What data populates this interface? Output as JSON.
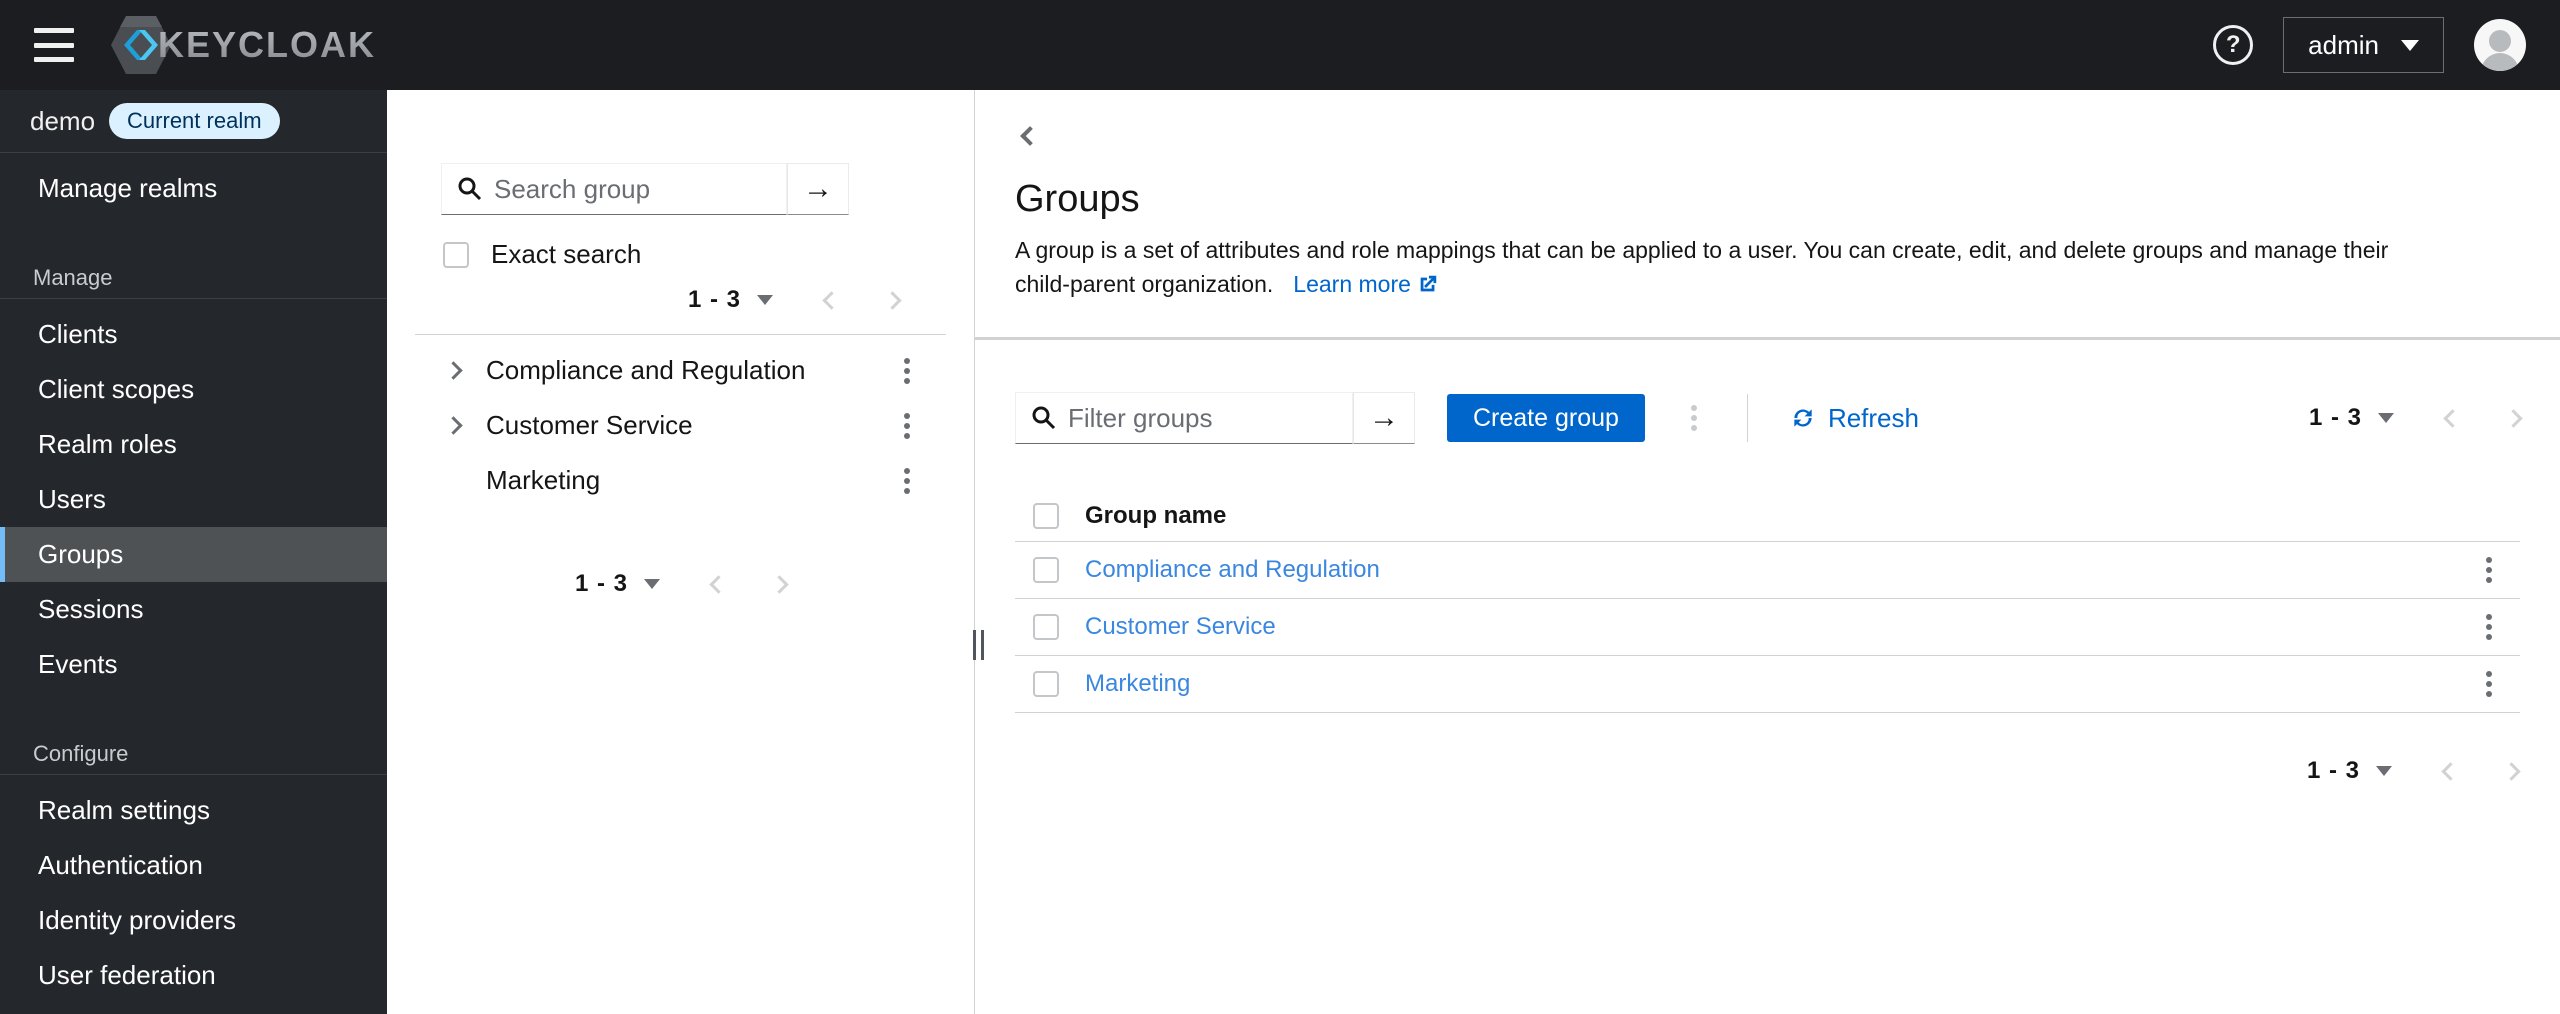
{
  "masthead": {
    "brand": "KEYCLOAK",
    "username": "admin"
  },
  "sidebar": {
    "realm_name": "demo",
    "realm_badge": "Current realm",
    "manage_realms": "Manage realms",
    "sections": [
      {
        "label": "Manage",
        "items": [
          {
            "label": "Clients"
          },
          {
            "label": "Client scopes"
          },
          {
            "label": "Realm roles"
          },
          {
            "label": "Users"
          },
          {
            "label": "Groups",
            "active": true
          },
          {
            "label": "Sessions"
          },
          {
            "label": "Events"
          }
        ]
      },
      {
        "label": "Configure",
        "items": [
          {
            "label": "Realm settings"
          },
          {
            "label": "Authentication"
          },
          {
            "label": "Identity providers"
          },
          {
            "label": "User federation"
          }
        ]
      }
    ]
  },
  "tree_panel": {
    "search_placeholder": "Search group",
    "exact_search_label": "Exact search",
    "pagination_range": "1 - 3",
    "items": [
      {
        "name": "Compliance and Regulation",
        "expandable": true
      },
      {
        "name": "Customer Service",
        "expandable": true
      },
      {
        "name": "Marketing",
        "expandable": false
      }
    ],
    "bottom_pagination_range": "1 - 3"
  },
  "main": {
    "title": "Groups",
    "description": "A group is a set of attributes and role mappings that can be applied to a user. You can create, edit, and delete groups and manage their child-parent organization.",
    "learn_more_label": "Learn more",
    "toolbar": {
      "filter_placeholder": "Filter groups",
      "create_button_label": "Create group",
      "refresh_label": "Refresh",
      "pagination_range": "1 - 3"
    },
    "table": {
      "column_header": "Group name",
      "rows": [
        {
          "name": "Compliance and Regulation"
        },
        {
          "name": "Customer Service"
        },
        {
          "name": "Marketing"
        }
      ]
    },
    "bottom_pagination_range": "1 - 3"
  },
  "colors": {
    "accent_blue": "#0066cc",
    "table_link_blue": "#3a87e0",
    "masthead_bg": "#1b1d21",
    "sidebar_bg": "#24272b",
    "active_nav_bg": "#4f5255",
    "active_nav_accent": "#73bcf7",
    "realm_badge_bg": "#dcf1ff",
    "realm_badge_text": "#00315c",
    "divider_gray": "#d2d2d2"
  }
}
